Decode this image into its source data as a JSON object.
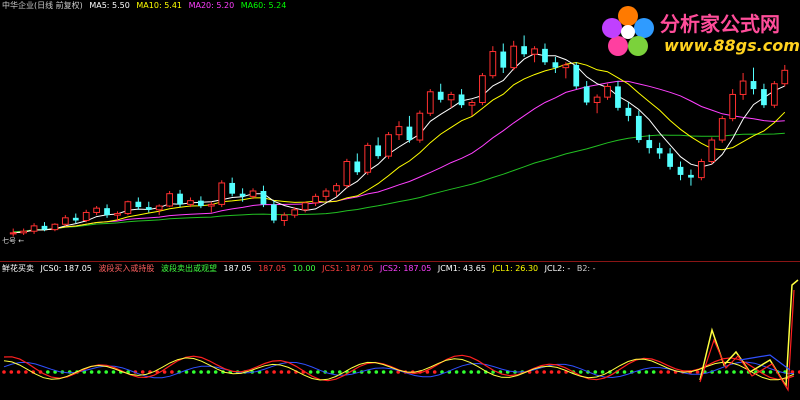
{
  "main_header": {
    "title": "中华企业(日线 前复权)",
    "ma5": "MA5: 5.50",
    "ma10": "MA10: 5.41",
    "ma20": "MA20: 5.20",
    "ma60": "MA60: 5.24",
    "title_color": "#cccccc",
    "ma5_color": "#ffffff",
    "ma10_color": "#ffff00",
    "ma20_color": "#ff40ff",
    "ma60_color": "#00ff00"
  },
  "indicator_header": {
    "name": "鲜花买卖",
    "jcs0": "JCS0: 187.05",
    "buy_signal": "波段买入或持股",
    "sell_signal": "波段卖出或观望",
    "v1": "187.05",
    "v2": "187.05",
    "v3": "10.00",
    "jcs1": "JCS1: 187.05",
    "jcs2": "JCS2: 187.05",
    "jcm1": "JCM1: 43.65",
    "jcl1": "JCL1: 26.30",
    "jcl2": "JCL2: -",
    "b2": "B2: -"
  },
  "watermark": {
    "title": "分析家公式网",
    "url": "www.88gs.com",
    "title_color": "#ff4d9a",
    "url_color": "#ffd21f"
  },
  "left_label": "七号 ←",
  "colors": {
    "up_candle": "#ff3030",
    "down_candle": "#54ffff",
    "background": "#000000",
    "ma5": "#ffffff",
    "ma10": "#ffff00",
    "ma20": "#ff40ff",
    "ma60": "#22c022",
    "ind_red": "#ff2020",
    "ind_yellow": "#ffff40",
    "ind_blue": "#3050ff",
    "ind_green": "#20c020",
    "flower_green": "#30ff30",
    "flower_red": "#ff2020"
  },
  "chart_data": {
    "type": "candlestick",
    "ma_labels": [
      "MA5",
      "MA10",
      "MA20",
      "MA60"
    ],
    "ohlc": [
      [
        4.1,
        4.2,
        4.05,
        4.12
      ],
      [
        4.12,
        4.2,
        4.08,
        4.15
      ],
      [
        4.15,
        4.3,
        4.1,
        4.25
      ],
      [
        4.25,
        4.32,
        4.15,
        4.18
      ],
      [
        4.18,
        4.3,
        4.15,
        4.28
      ],
      [
        4.28,
        4.45,
        4.25,
        4.4
      ],
      [
        4.4,
        4.48,
        4.3,
        4.35
      ],
      [
        4.35,
        4.55,
        4.32,
        4.5
      ],
      [
        4.5,
        4.62,
        4.45,
        4.58
      ],
      [
        4.58,
        4.65,
        4.4,
        4.45
      ],
      [
        4.45,
        4.52,
        4.35,
        4.48
      ],
      [
        4.48,
        4.72,
        4.45,
        4.7
      ],
      [
        4.7,
        4.78,
        4.55,
        4.6
      ],
      [
        4.6,
        4.7,
        4.5,
        4.55
      ],
      [
        4.55,
        4.65,
        4.45,
        4.62
      ],
      [
        4.62,
        4.9,
        4.6,
        4.85
      ],
      [
        4.85,
        4.92,
        4.6,
        4.65
      ],
      [
        4.65,
        4.78,
        4.6,
        4.72
      ],
      [
        4.72,
        4.8,
        4.58,
        4.62
      ],
      [
        4.62,
        4.7,
        4.5,
        4.65
      ],
      [
        4.65,
        5.1,
        4.6,
        5.05
      ],
      [
        5.05,
        5.15,
        4.8,
        4.85
      ],
      [
        4.85,
        4.95,
        4.7,
        4.8
      ],
      [
        4.8,
        4.95,
        4.75,
        4.9
      ],
      [
        4.9,
        5.0,
        4.6,
        4.65
      ],
      [
        4.65,
        4.72,
        4.3,
        4.35
      ],
      [
        4.35,
        4.5,
        4.25,
        4.45
      ],
      [
        4.45,
        4.6,
        4.4,
        4.55
      ],
      [
        4.55,
        4.7,
        4.5,
        4.68
      ],
      [
        4.68,
        4.85,
        4.62,
        4.8
      ],
      [
        4.8,
        4.95,
        4.72,
        4.9
      ],
      [
        4.9,
        5.05,
        4.8,
        5.0
      ],
      [
        5.0,
        5.5,
        4.95,
        5.45
      ],
      [
        5.45,
        5.6,
        5.2,
        5.25
      ],
      [
        5.25,
        5.8,
        5.2,
        5.75
      ],
      [
        5.75,
        5.9,
        5.5,
        5.55
      ],
      [
        5.55,
        6.0,
        5.5,
        5.95
      ],
      [
        5.95,
        6.2,
        5.85,
        6.1
      ],
      [
        6.1,
        6.3,
        5.8,
        5.85
      ],
      [
        5.85,
        6.4,
        5.8,
        6.35
      ],
      [
        6.35,
        6.8,
        6.3,
        6.75
      ],
      [
        6.75,
        6.9,
        6.55,
        6.6
      ],
      [
        6.6,
        6.75,
        6.45,
        6.7
      ],
      [
        6.7,
        6.8,
        6.45,
        6.5
      ],
      [
        6.5,
        6.6,
        6.3,
        6.55
      ],
      [
        6.55,
        7.1,
        6.5,
        7.05
      ],
      [
        7.05,
        7.6,
        7.0,
        7.5
      ],
      [
        7.5,
        7.65,
        7.1,
        7.2
      ],
      [
        7.2,
        7.7,
        7.15,
        7.6
      ],
      [
        7.6,
        7.8,
        7.4,
        7.45
      ],
      [
        7.45,
        7.6,
        7.3,
        7.55
      ],
      [
        7.55,
        7.65,
        7.25,
        7.3
      ],
      [
        7.3,
        7.4,
        7.1,
        7.2
      ],
      [
        7.2,
        7.3,
        7.0,
        7.25
      ],
      [
        7.25,
        7.3,
        6.8,
        6.85
      ],
      [
        6.85,
        6.95,
        6.5,
        6.55
      ],
      [
        6.55,
        6.7,
        6.35,
        6.65
      ],
      [
        6.65,
        6.9,
        6.6,
        6.85
      ],
      [
        6.85,
        6.95,
        6.4,
        6.45
      ],
      [
        6.45,
        6.55,
        6.2,
        6.3
      ],
      [
        6.3,
        6.4,
        5.8,
        5.85
      ],
      [
        5.85,
        5.95,
        5.6,
        5.7
      ],
      [
        5.7,
        5.8,
        5.5,
        5.6
      ],
      [
        5.6,
        5.7,
        5.3,
        5.35
      ],
      [
        5.35,
        5.45,
        5.1,
        5.2
      ],
      [
        5.2,
        5.3,
        5.0,
        5.15
      ],
      [
        5.15,
        5.5,
        5.1,
        5.45
      ],
      [
        5.45,
        5.9,
        5.4,
        5.85
      ],
      [
        5.85,
        6.3,
        5.8,
        6.25
      ],
      [
        6.25,
        6.8,
        6.2,
        6.7
      ],
      [
        6.7,
        7.1,
        6.6,
        6.95
      ],
      [
        6.95,
        7.2,
        6.7,
        6.8
      ],
      [
        6.8,
        6.9,
        6.45,
        6.5
      ],
      [
        6.5,
        6.95,
        6.45,
        6.9
      ],
      [
        6.9,
        7.25,
        6.85,
        7.15
      ]
    ],
    "x_range": [
      0,
      74
    ],
    "y_range": [
      3.8,
      8.2
    ],
    "grid": false
  }
}
